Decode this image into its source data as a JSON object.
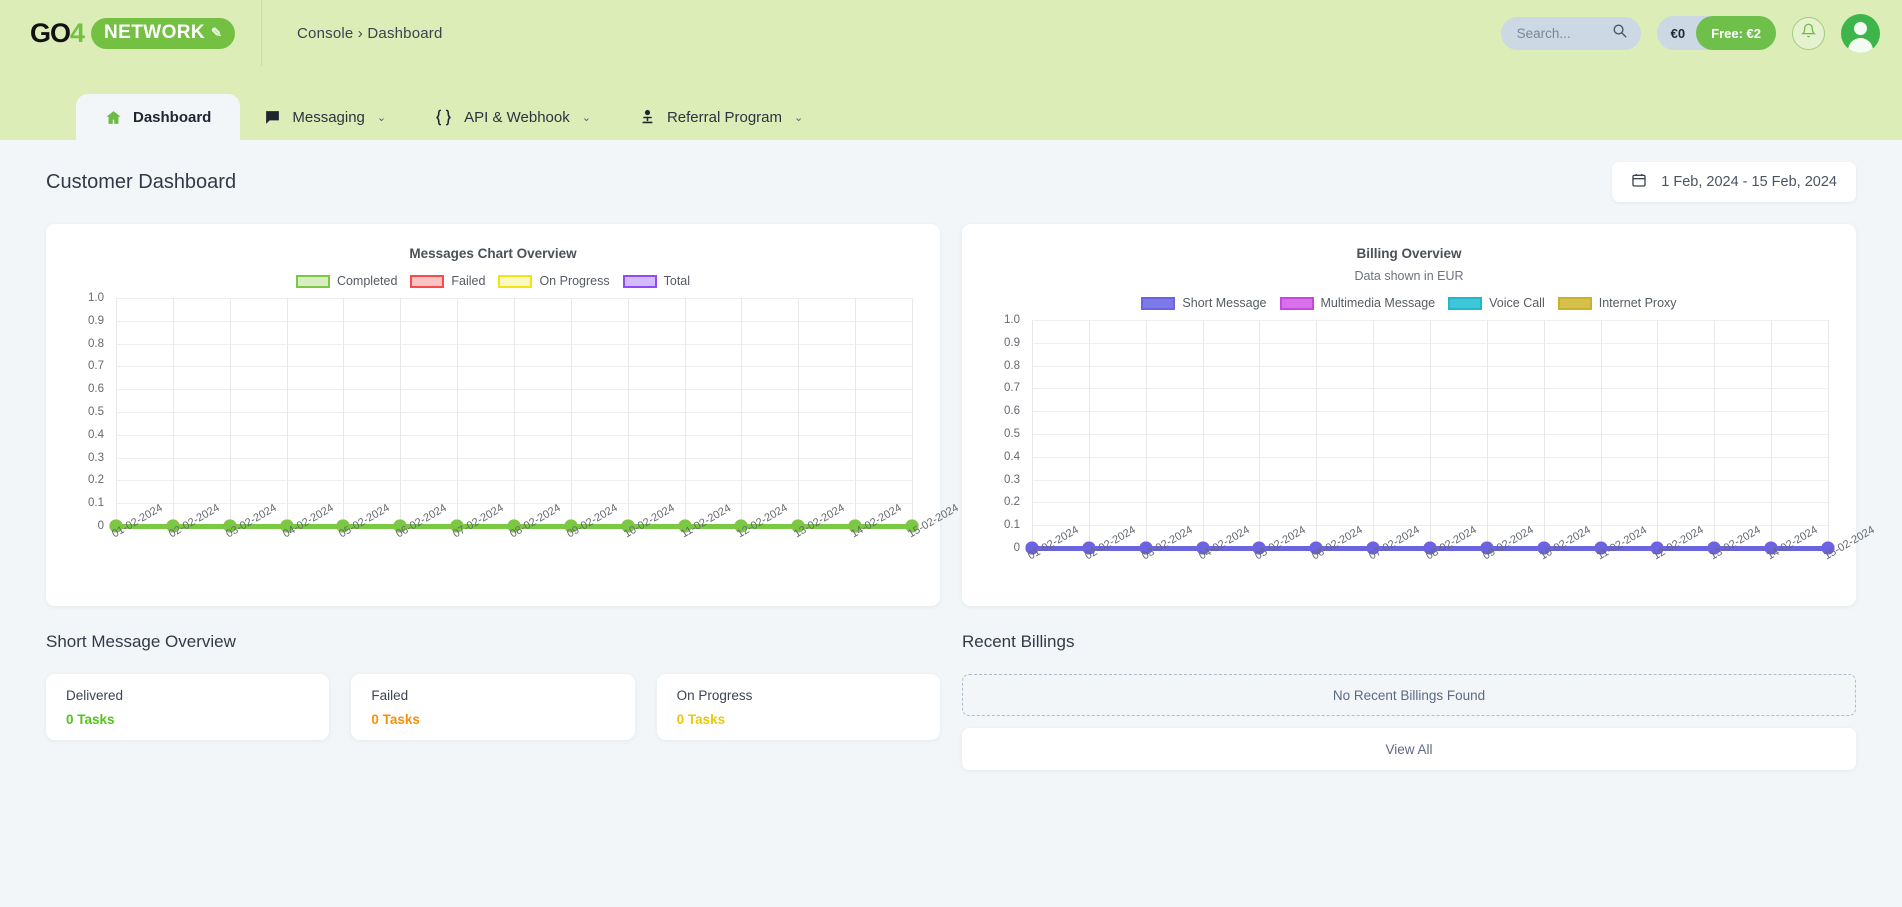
{
  "header": {
    "logo_text": "GO4",
    "logo_pill": "NETWORK",
    "breadcrumb": "Console › Dashboard",
    "search_placeholder": "Search...",
    "credit_amount": "€0",
    "credit_free": "Free: €2",
    "brand_green": "#74c043",
    "bar_bg": "#dcedb8"
  },
  "tabs": [
    {
      "label": "Dashboard",
      "icon": "home-icon",
      "active": true,
      "caret": ""
    },
    {
      "label": "Messaging",
      "icon": "chat-icon",
      "active": false,
      "caret": "⌄"
    },
    {
      "label": "API & Webhook",
      "icon": "braces-icon",
      "active": false,
      "caret": "⌄"
    },
    {
      "label": "Referral Program",
      "icon": "person-icon",
      "active": false,
      "caret": "⌄"
    }
  ],
  "page": {
    "title": "Customer Dashboard",
    "date_range": "1 Feb, 2024 - 15 Feb, 2024"
  },
  "chart_data": [
    {
      "type": "line",
      "title": "Messages Chart Overview",
      "subtitle": "",
      "xlabel": "",
      "ylabel": "",
      "ylim": [
        0,
        1.0
      ],
      "grid": true,
      "legend_position": "top",
      "yticks": [
        "1.0",
        "0.9",
        "0.8",
        "0.7",
        "0.6",
        "0.5",
        "0.4",
        "0.3",
        "0.2",
        "0.1",
        "0"
      ],
      "categories": [
        "01-02-2024",
        "02-02-2024",
        "03-02-2024",
        "04-02-2024",
        "05-02-2024",
        "06-02-2024",
        "07-02-2024",
        "08-02-2024",
        "09-02-2024",
        "10-02-2024",
        "11-02-2024",
        "12-02-2024",
        "13-02-2024",
        "14-02-2024",
        "15-02-2024"
      ],
      "series": [
        {
          "name": "Completed",
          "color": "#7ac943",
          "fill": "#d9edc2",
          "values": [
            0,
            0,
            0,
            0,
            0,
            0,
            0,
            0,
            0,
            0,
            0,
            0,
            0,
            0,
            0
          ]
        },
        {
          "name": "Failed",
          "color": "#fa4b4b",
          "fill": "#fcc3c3",
          "values": [
            0,
            0,
            0,
            0,
            0,
            0,
            0,
            0,
            0,
            0,
            0,
            0,
            0,
            0,
            0
          ]
        },
        {
          "name": "On Progress",
          "color": "#f2e312",
          "fill": "#fbf8c2",
          "values": [
            0,
            0,
            0,
            0,
            0,
            0,
            0,
            0,
            0,
            0,
            0,
            0,
            0,
            0,
            0
          ]
        },
        {
          "name": "Total",
          "color": "#9149fa",
          "fill": "#d3bcfc",
          "values": [
            0,
            0,
            0,
            0,
            0,
            0,
            0,
            0,
            0,
            0,
            0,
            0,
            0,
            0,
            0
          ]
        }
      ]
    },
    {
      "type": "line",
      "title": "Billing Overview",
      "subtitle": "Data shown in EUR",
      "xlabel": "",
      "ylabel": "",
      "ylim": [
        0,
        1.0
      ],
      "grid": true,
      "legend_position": "top",
      "yticks": [
        "1.0",
        "0.9",
        "0.8",
        "0.7",
        "0.6",
        "0.5",
        "0.4",
        "0.3",
        "0.2",
        "0.1",
        "0"
      ],
      "categories": [
        "01-02-2024",
        "02-02-2024",
        "03-02-2024",
        "04-02-2024",
        "05-02-2024",
        "06-02-2024",
        "07-02-2024",
        "08-02-2024",
        "09-02-2024",
        "10-02-2024",
        "11-02-2024",
        "12-02-2024",
        "13-02-2024",
        "14-02-2024",
        "15-02-2024"
      ],
      "series": [
        {
          "name": "Short Message",
          "color": "#6c63e0",
          "fill": "#7e79e8",
          "values": [
            0,
            0,
            0,
            0,
            0,
            0,
            0,
            0,
            0,
            0,
            0,
            0,
            0,
            0,
            0
          ]
        },
        {
          "name": "Multimedia Message",
          "color": "#c846e0",
          "fill": "#d772ea",
          "values": [
            0,
            0,
            0,
            0,
            0,
            0,
            0,
            0,
            0,
            0,
            0,
            0,
            0,
            0,
            0
          ]
        },
        {
          "name": "Voice Call",
          "color": "#1fb8cf",
          "fill": "#3fc6d9",
          "values": [
            0,
            0,
            0,
            0,
            0,
            0,
            0,
            0,
            0,
            0,
            0,
            0,
            0,
            0,
            0
          ]
        },
        {
          "name": "Internet Proxy",
          "color": "#c9b226",
          "fill": "#d4c04a",
          "values": [
            0,
            0,
            0,
            0,
            0,
            0,
            0,
            0,
            0,
            0,
            0,
            0,
            0,
            0,
            0
          ]
        }
      ]
    }
  ],
  "short_message_overview": {
    "title": "Short Message Overview",
    "cards": [
      {
        "label": "Delivered",
        "value": "0 Tasks",
        "color": "#53c41a"
      },
      {
        "label": "Failed",
        "value": "0 Tasks",
        "color": "#f79009"
      },
      {
        "label": "On Progress",
        "value": "0 Tasks",
        "color": "#ecc80a"
      }
    ]
  },
  "recent_billings": {
    "title": "Recent Billings",
    "empty_text": "No Recent Billings Found",
    "view_all": "View All"
  }
}
